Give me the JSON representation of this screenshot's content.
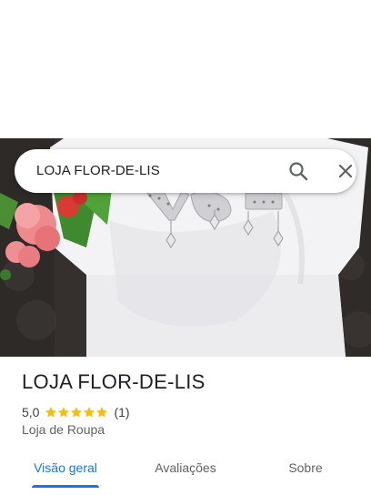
{
  "search": {
    "query": "LOJA FLOR-DE-LIS",
    "search_icon": "search-icon",
    "close_icon": "close-icon"
  },
  "photo": {
    "subject": "white-tshirt-with-flowers"
  },
  "place": {
    "name": "LOJA FLOR-DE-LIS",
    "rating": "5,0",
    "stars": 5,
    "review_count": "(1)",
    "category": "Loja de Roupa"
  },
  "tabs": [
    {
      "label": "Visão geral",
      "active": true
    },
    {
      "label": "Avaliações",
      "active": false
    },
    {
      "label": "Sobre",
      "active": false
    }
  ],
  "colors": {
    "accent": "#1a73e8",
    "star": "#fbbc04",
    "text_primary": "#202124",
    "text_secondary": "#5f6368"
  }
}
